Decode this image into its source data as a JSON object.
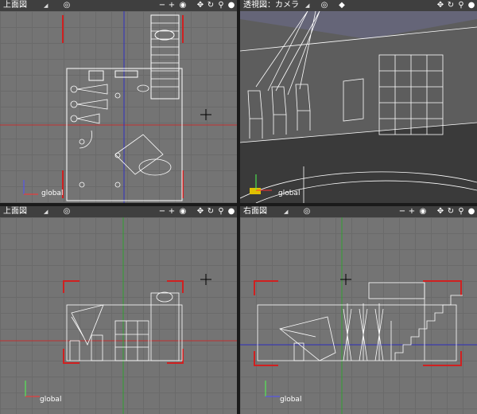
{
  "viewports": {
    "top_left": {
      "title": "上面図",
      "caret": "◢",
      "axis_label": "global"
    },
    "top_right": {
      "title": "透視図：カメラ",
      "caret": "◢",
      "axis_label": "global"
    },
    "bottom_left": {
      "title": "上面図",
      "caret": "◢",
      "axis_label": "global"
    },
    "bottom_right": {
      "title": "右面図",
      "caret": "◢",
      "axis_label": "global"
    }
  },
  "toolbar_icons": [
    "view-menu-icon",
    "zoom-out-icon",
    "zoom-in-icon",
    "camera-icon",
    "pan-icon",
    "rotate-icon",
    "zoom-icon",
    "sphere-icon"
  ],
  "colors": {
    "header": "#3f3f3f",
    "viewport_bg": "#747474",
    "frame_red": "#d02020",
    "grid": "#6a6a6a",
    "axis_red": "#c03030",
    "axis_blue": "#3030c0",
    "axis_green": "#30a030"
  }
}
